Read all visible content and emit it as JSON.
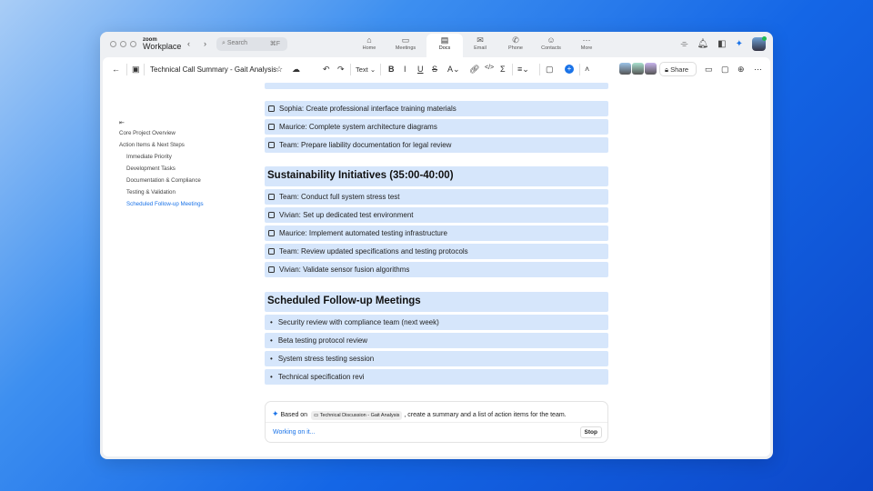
{
  "app": {
    "brand_small": "zoom",
    "brand": "Workplace",
    "search_placeholder": "Search",
    "search_shortcut": "⌘F"
  },
  "tabs": [
    {
      "label": "Home",
      "icon": "⌂"
    },
    {
      "label": "Meetings",
      "icon": "▭"
    },
    {
      "label": "Docs",
      "icon": "▤"
    },
    {
      "label": "Email",
      "icon": "✉"
    },
    {
      "label": "Phone",
      "icon": "✆"
    },
    {
      "label": "Contacts",
      "icon": "☺"
    },
    {
      "label": "More",
      "icon": "···"
    }
  ],
  "toolbar": {
    "title": "Technical Call Summary - Gait Analysis",
    "text_style": "Text",
    "share": "Share"
  },
  "toc": {
    "items": [
      "Core Project Overview",
      "Action Items & Next Steps",
      "Immediate Priority",
      "Development Tasks",
      "Documentation & Compliance",
      "Testing & Validation",
      "Scheduled Follow-up Meetings"
    ],
    "active_color": "#1a73e8"
  },
  "doc": {
    "top_tasks": [
      "Sophia: Create professional interface training materials",
      "Maurice: Complete system architecture diagrams",
      "Team: Prepare liability documentation for legal review"
    ],
    "section1": {
      "title": "Sustainability Initiatives (35:00-40:00)",
      "tasks": [
        "Team: Conduct full system stress test",
        "Vivian: Set up dedicated test environment",
        "Maurice: Implement automated testing infrastructure",
        "Team: Review updated specifications and testing protocols",
        "Vivian: Validate sensor fusion algorithms"
      ]
    },
    "section2": {
      "title": "Scheduled Follow-up Meetings",
      "bullets": [
        "Security review with compliance team (next week)",
        "Beta testing protocol review",
        "System stress testing session",
        "Technical specification revi"
      ]
    }
  },
  "ai": {
    "prefix": "Based on",
    "chip": "Technical Discussion - Gait Analysis",
    "suffix": ", create a summary and a list of action items for the team.",
    "status": "Working on it...",
    "stop": "Stop"
  }
}
